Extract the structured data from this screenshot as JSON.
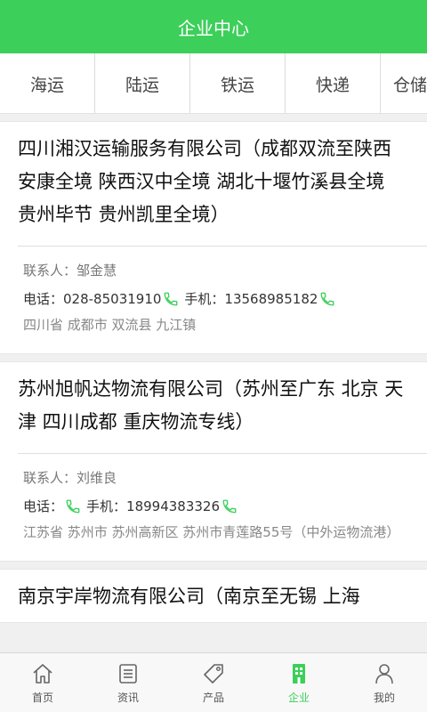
{
  "header": {
    "title": "企业中心"
  },
  "tabs": [
    "海运",
    "陆运",
    "铁运",
    "快递",
    "仓储"
  ],
  "companies": [
    {
      "name": "四川湘汉运输服务有限公司（成都双流至陕西安康全境 陕西汉中全境 湖北十堰竹溪县全境 贵州毕节 贵州凯里全境）",
      "contact_label": "联系人：",
      "contact": "邹金慧",
      "phone_label": "电话：",
      "phone": "028-85031910",
      "mobile_label": "手机：",
      "mobile": "13568985182",
      "address": "四川省 成都市 双流县 九江镇"
    },
    {
      "name": "苏州旭帆达物流有限公司（苏州至广东 北京 天津 四川成都 重庆物流专线）",
      "contact_label": "联系人：",
      "contact": "刘维良",
      "phone_label": "电话：",
      "phone": "",
      "mobile_label": "手机：",
      "mobile": "18994383326",
      "address": "江苏省 苏州市 苏州高新区 苏州市青莲路55号（中外运物流港）"
    },
    {
      "name": "南京宇岸物流有限公司（南京至无锡 上海"
    }
  ],
  "bottom_nav": [
    {
      "label": "首页",
      "icon": "home-icon"
    },
    {
      "label": "资讯",
      "icon": "news-icon"
    },
    {
      "label": "产品",
      "icon": "tag-icon"
    },
    {
      "label": "企业",
      "icon": "building-icon",
      "active": true
    },
    {
      "label": "我的",
      "icon": "user-icon"
    }
  ],
  "colors": {
    "accent": "#3ccf5a"
  }
}
